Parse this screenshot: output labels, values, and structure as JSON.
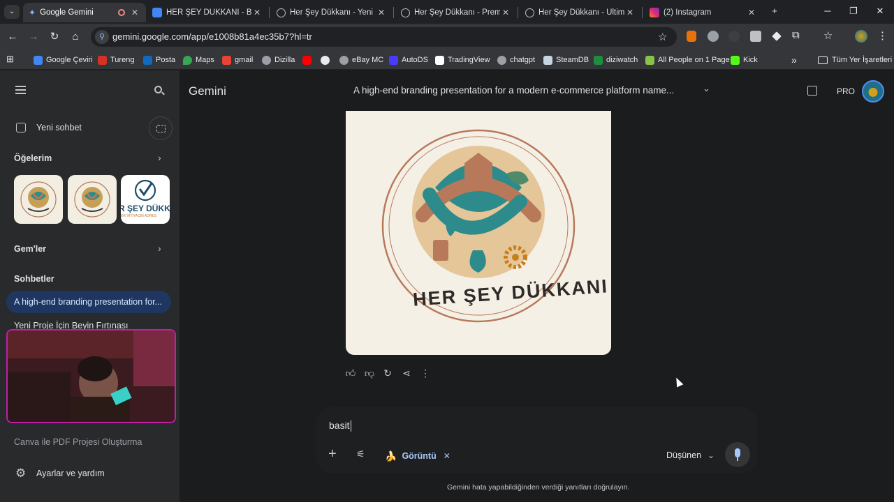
{
  "tabs": [
    {
      "title": "Google Gemini",
      "icon": "gemini-icon",
      "active": true,
      "status": "recording-dot"
    },
    {
      "title": "HER ŞEY DÜKKANI - Belge",
      "icon": "docs-icon"
    },
    {
      "title": "Her Şey Dükkanı - Yeni Ko",
      "icon": "globe-icon"
    },
    {
      "title": "Her Şey Dükkanı - Premiu",
      "icon": "globe-icon"
    },
    {
      "title": "Her Şey Dükkanı - Ultimat",
      "icon": "globe-icon"
    },
    {
      "title": "(2) Instagram",
      "icon": "instagram-icon"
    }
  ],
  "tab_close_glyph": "✕",
  "new_tab_glyph": "+",
  "address_bar": {
    "url": "gemini.google.com/app/e1008b81a4ec35b7?hl=tr"
  },
  "bookmarks": [
    {
      "label": "Google Çeviri",
      "color": "#4285f4"
    },
    {
      "label": "Tureng",
      "color": "#d93025"
    },
    {
      "label": "Posta",
      "color": "#0f6cbd"
    },
    {
      "label": "Maps",
      "color": "#34a853"
    },
    {
      "label": "gmail",
      "color": "#ea4335"
    },
    {
      "label": "Dizilla",
      "color": "#9aa0a6"
    },
    {
      "label": "",
      "color": "#ff0000"
    },
    {
      "label": "",
      "color": "#9aa0a6"
    },
    {
      "label": "eBay MC",
      "color": "#9aa0a6"
    },
    {
      "label": "AutoDS",
      "color": "#4a3aff"
    },
    {
      "label": "TradingView",
      "color": "#131722"
    },
    {
      "label": "chatgpt",
      "color": "#9aa0a6"
    },
    {
      "label": "SteamDB",
      "color": "#c7d5e0"
    },
    {
      "label": "diziwatch",
      "color": "#1e8e3e"
    },
    {
      "label": "All People on 1 Page",
      "color": "#8bc34a"
    },
    {
      "label": "Kick",
      "color": "#53fc18"
    }
  ],
  "bookmarks_overflow": "»",
  "all_bookmarks": "Tüm Yer İşaretleri",
  "sidebar": {
    "new_chat": "Yeni sohbet",
    "items_header": "Öğelerim",
    "thumb3_text_top": "R ŞEY DÜKK",
    "thumb3_text_bottom": "ER İHTİYACIN ADRES",
    "gems_header": "Gem'ler",
    "chats_header": "Sohbetler",
    "chats": [
      "A high-end branding presentation for...",
      "Yeni Proje İçin Beyin Fırtınası",
      "Canva ile PDF Projesi Oluşturma"
    ],
    "settings": "Ayarlar ve yardım"
  },
  "header": {
    "app_name": "Gemini",
    "chat_title": "A high-end branding presentation for a modern e-commerce platform name...",
    "pro_badge": "PRO"
  },
  "logo": {
    "text": "HER ŞEY DÜKKANI"
  },
  "composer": {
    "input_value": "basit",
    "tool_chip": "Görüntü",
    "chip_emoji": "🍌",
    "mode": "Düşünen"
  },
  "disclaimer": "Gemini hata yapabildiğinden verdiği yanıtları doğrulayın.",
  "colors": {
    "accent": "#a8c7fa",
    "active_chat": "#1f3760",
    "sidebar": "#282a2c",
    "main": "#1b1c1d"
  }
}
